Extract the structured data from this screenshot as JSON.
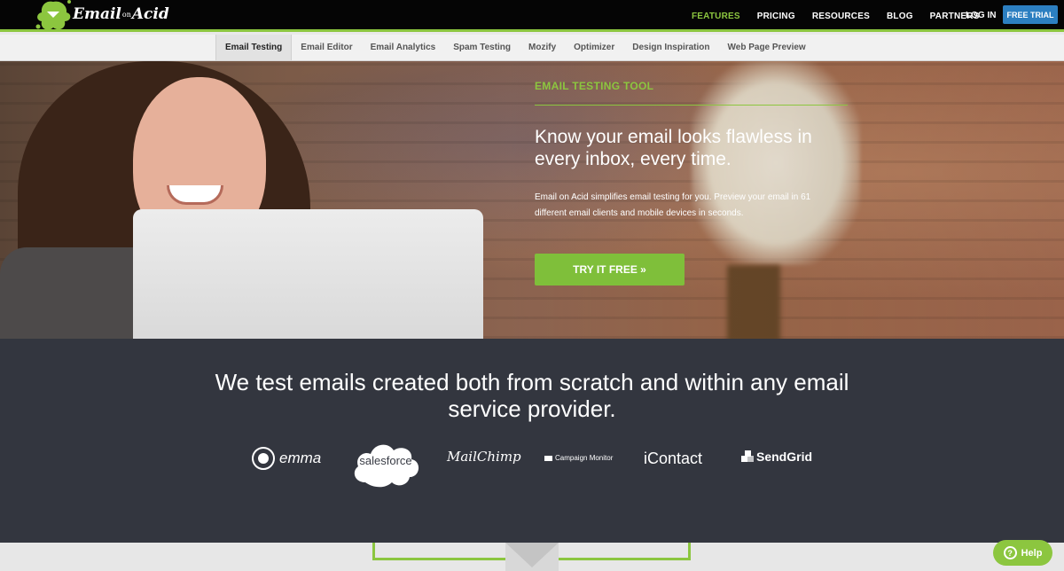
{
  "header": {
    "logo_text": "Email",
    "logo_on": "on",
    "logo_acid": "Acid",
    "nav": [
      {
        "label": "FEATURES",
        "active": true
      },
      {
        "label": "PRICING"
      },
      {
        "label": "RESOURCES"
      },
      {
        "label": "BLOG"
      },
      {
        "label": "PARTNERS"
      }
    ],
    "login_label": "LOG IN",
    "trial_label": "FREE TRIAL"
  },
  "subnav": {
    "items": [
      "Email Testing",
      "Email Editor",
      "Email Analytics",
      "Spam Testing",
      "Mozify",
      "Optimizer",
      "Design Inspiration",
      "Web Page Preview"
    ]
  },
  "hero": {
    "eyebrow": "EMAIL TESTING TOOL",
    "headline": "Know your email looks flawless in every inbox, every time.",
    "description": "Email on Acid simplifies email testing for you. Preview your email in 61 different email clients and mobile devices in seconds.",
    "cta_label": "TRY IT FREE »"
  },
  "providers": {
    "title": "We test emails created both from scratch and within any email service provider.",
    "logos": [
      "emma",
      "salesforce",
      "MailChimp",
      "Campaign Monitor",
      "iContact",
      "SendGrid"
    ]
  },
  "help": {
    "label": "Help",
    "icon": "?"
  },
  "colors": {
    "accent_green": "#8cc63f",
    "trial_blue": "#2c7fc1",
    "band_dark": "#33363f"
  }
}
